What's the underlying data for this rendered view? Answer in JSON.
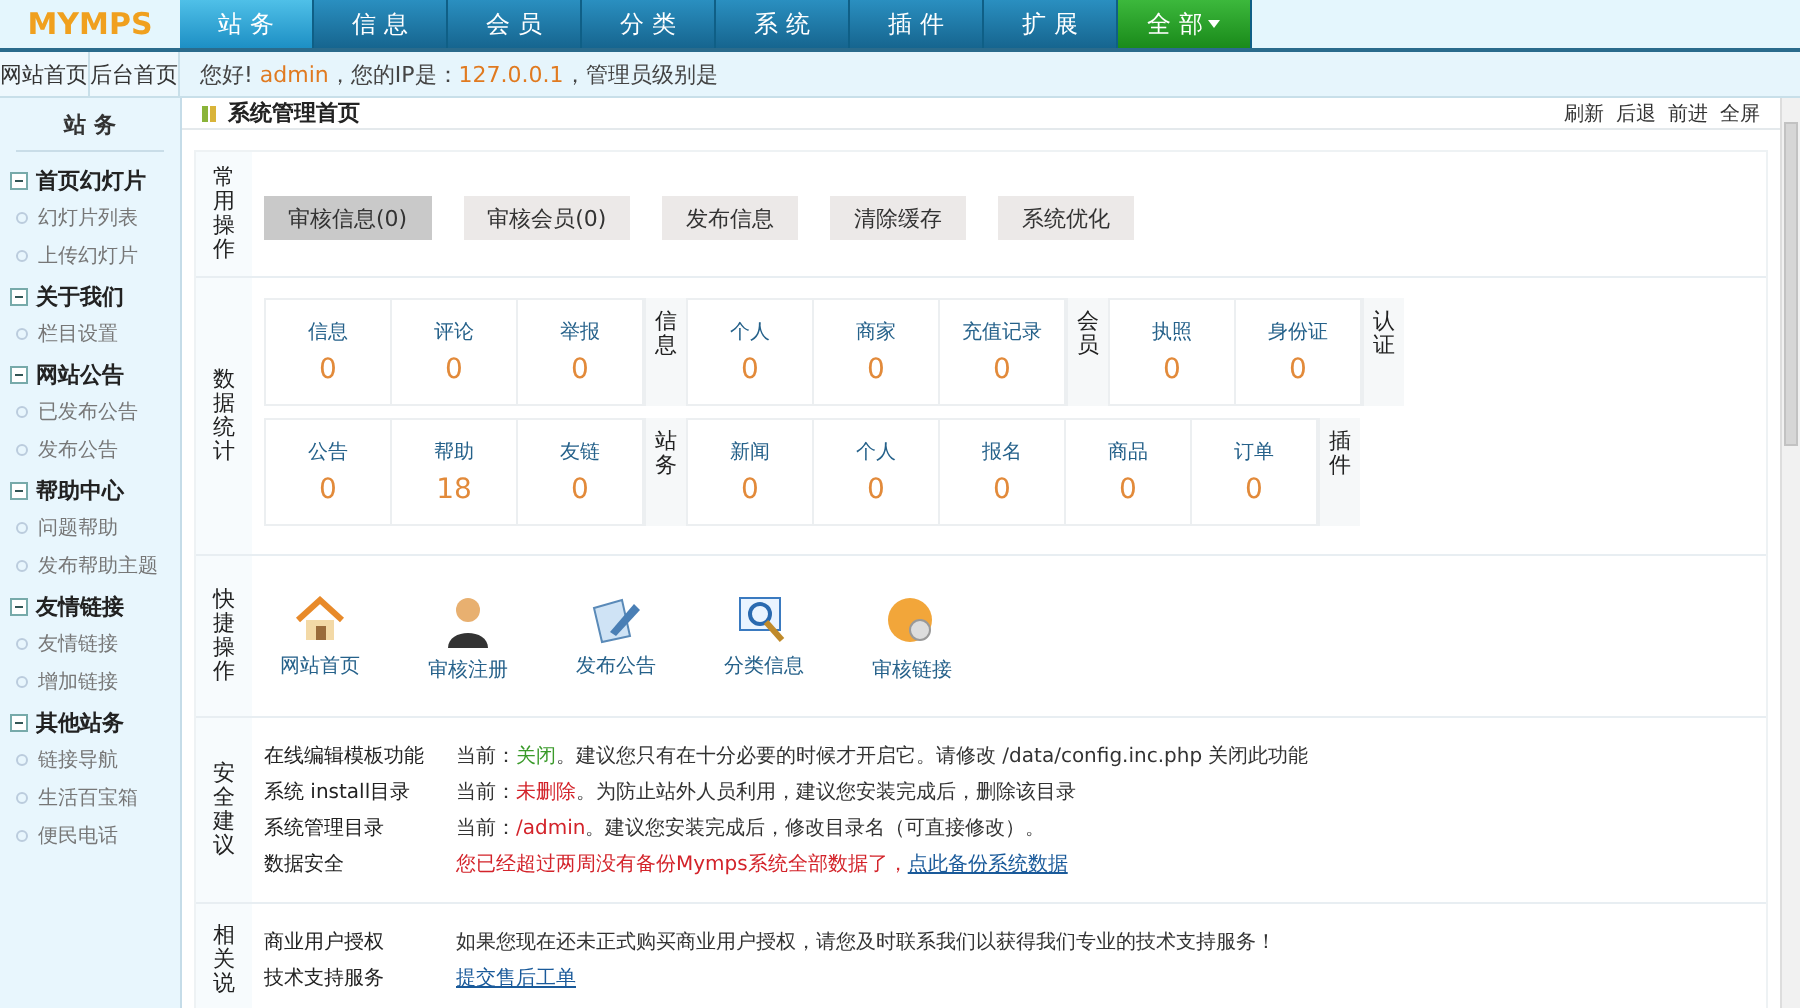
{
  "logo": "MYMPS",
  "nav": [
    {
      "label": "站 务",
      "selected": true
    },
    {
      "label": "信 息",
      "selected": false
    },
    {
      "label": "会 员",
      "selected": false
    },
    {
      "label": "分 类",
      "selected": false
    },
    {
      "label": "系 统",
      "selected": false
    },
    {
      "label": "插 件",
      "selected": false
    },
    {
      "label": "扩 展",
      "selected": false
    },
    {
      "label": "全 部",
      "selected": false,
      "kind": "dropdown"
    }
  ],
  "subtabs": [
    "网站首页",
    "后台首页"
  ],
  "greeting": [
    {
      "text": "您好! ",
      "highlight": false
    },
    {
      "text": "admin",
      "highlight": true
    },
    {
      "text": "，您的IP是：",
      "highlight": false
    },
    {
      "text": "127.0.0.1",
      "highlight": true
    },
    {
      "text": "，管理员级别是",
      "highlight": false
    }
  ],
  "sidebar": {
    "title": "站 务",
    "groups": [
      {
        "label": "首页幻灯片",
        "expanded": true,
        "children": [
          "幻灯片列表",
          "上传幻灯片"
        ]
      },
      {
        "label": "关于我们",
        "expanded": true,
        "children": [
          "栏目设置"
        ]
      },
      {
        "label": "网站公告",
        "expanded": true,
        "children": [
          "已发布公告",
          "发布公告"
        ]
      },
      {
        "label": "帮助中心",
        "expanded": true,
        "children": [
          "问题帮助",
          "发布帮助主题"
        ]
      },
      {
        "label": "友情链接",
        "expanded": true,
        "children": [
          "友情链接",
          "增加链接"
        ]
      },
      {
        "label": "其他站务",
        "expanded": true,
        "children": [
          "链接导航",
          "生活百宝箱",
          "便民电话"
        ]
      }
    ]
  },
  "page_title": "系统管理首页",
  "page_links": [
    "刷新",
    "后退",
    "前进",
    "全屏"
  ],
  "common": {
    "label": "常用操作",
    "buttons": [
      {
        "label": "审核信息(0)",
        "selected": true
      },
      {
        "label": "审核会员(0)",
        "selected": false
      },
      {
        "label": "发布信息",
        "selected": false
      },
      {
        "label": "清除缓存",
        "selected": false
      },
      {
        "label": "系统优化",
        "selected": false
      }
    ]
  },
  "stats": {
    "label": "数据统计",
    "rows": [
      [
        {
          "label": "信息",
          "cells": [
            {
              "name": "信息",
              "value": "0"
            },
            {
              "name": "评论",
              "value": "0"
            },
            {
              "name": "举报",
              "value": "0"
            }
          ]
        },
        {
          "label": "会员",
          "cells": [
            {
              "name": "个人",
              "value": "0"
            },
            {
              "name": "商家",
              "value": "0"
            },
            {
              "name": "充值记录",
              "value": "0"
            }
          ]
        },
        {
          "label": "认证",
          "cells": [
            {
              "name": "执照",
              "value": "0"
            },
            {
              "name": "身份证",
              "value": "0"
            }
          ]
        }
      ],
      [
        {
          "label": "站务",
          "cells": [
            {
              "name": "公告",
              "value": "0"
            },
            {
              "name": "帮助",
              "value": "18"
            },
            {
              "name": "友链",
              "value": "0"
            }
          ]
        },
        {
          "label": "插件",
          "cells": [
            {
              "name": "新闻",
              "value": "0"
            },
            {
              "name": "个人",
              "value": "0"
            },
            {
              "name": "报名",
              "value": "0"
            },
            {
              "name": "商品",
              "value": "0"
            },
            {
              "name": "订单",
              "value": "0"
            }
          ]
        }
      ]
    ]
  },
  "quick": {
    "label": "快捷操作",
    "items": [
      {
        "label": "网站首页",
        "kind": "house"
      },
      {
        "label": "审核注册",
        "kind": "person"
      },
      {
        "label": "发布公告",
        "kind": "pen"
      },
      {
        "label": "分类信息",
        "kind": "magnifier"
      },
      {
        "label": "审核链接",
        "kind": "gear"
      }
    ]
  },
  "security": {
    "label": "安全建议",
    "rows": [
      {
        "name": "在线编辑模板功能",
        "parts": [
          {
            "text": "当前：",
            "kind": "plain"
          },
          {
            "text": "关闭",
            "kind": "good"
          },
          {
            "text": "。建议您只有在十分必要的时候才开启它。请修改 /data/config.inc.php 关闭此功能",
            "kind": "plain"
          }
        ]
      },
      {
        "name": "系统 install目录",
        "parts": [
          {
            "text": "当前：",
            "kind": "plain"
          },
          {
            "text": "未删除",
            "kind": "warning"
          },
          {
            "text": "。为防止站外人员利用，建议您安装完成后，删除该目录",
            "kind": "plain"
          }
        ]
      },
      {
        "name": "系统管理目录",
        "parts": [
          {
            "text": "当前：",
            "kind": "plain"
          },
          {
            "text": "/admin",
            "kind": "warning"
          },
          {
            "text": "。建议您安装完成后，修改目录名（可直接修改）。",
            "kind": "plain"
          }
        ]
      },
      {
        "name": "数据安全",
        "parts": [
          {
            "text": "您已经超过两周没有备份Mymps系统全部数据了，",
            "kind": "warning"
          },
          {
            "text": "点此备份系统数据",
            "kind": "link"
          }
        ]
      }
    ]
  },
  "about": {
    "label": "相关说",
    "rows": [
      {
        "name": "商业用户授权",
        "parts": [
          {
            "text": "如果您现在还未正式购买商业用户授权，请您及时联系我们以获得我们专业的技术支持服务！",
            "kind": "plain"
          }
        ]
      },
      {
        "name": "技术支持服务",
        "parts": [
          {
            "text": "提交售后工单",
            "kind": "link"
          }
        ]
      }
    ]
  }
}
